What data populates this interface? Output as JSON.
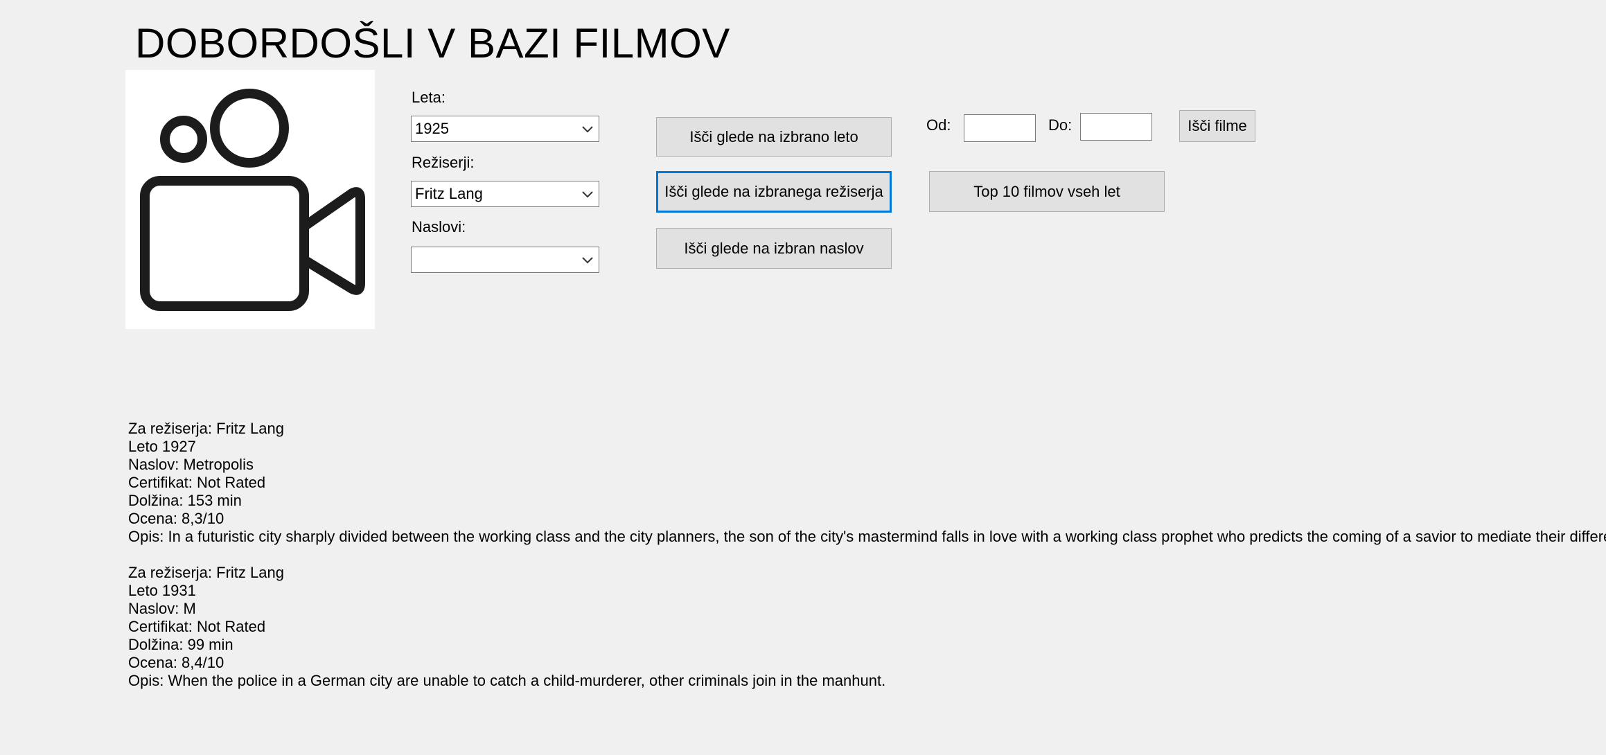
{
  "header": {
    "title": "DOBORDOŠLI V BAZI FILMOV"
  },
  "logo": {
    "icon": "video-camera-icon"
  },
  "filters": {
    "year_label": "Leta:",
    "year_value": "1925",
    "director_label": "Režiserji:",
    "director_value": "Fritz Lang",
    "title_label": "Naslovi:",
    "title_value": ""
  },
  "buttons": {
    "search_year": "Išči glede na izbrano leto",
    "search_director": "Išči glede na izbranega režiserja",
    "search_title": "Išči glede na izbran naslov",
    "top10": "Top 10 filmov vseh let",
    "search_films": "Išči filme"
  },
  "range": {
    "from_label": "Od:",
    "from_value": "",
    "to_label": "Do:",
    "to_value": ""
  },
  "results": [
    {
      "director": "Za režiserja: Fritz Lang",
      "year": "Leto 1927",
      "title": "Naslov: Metropolis",
      "certificate": "Certifikat: Not Rated",
      "length": "Dolžina: 153 min",
      "rating": "Ocena: 8,3/10",
      "description": "Opis: In a futuristic city sharply divided between the working class and the city planners, the son of the city's mastermind falls in love with a working class prophet who predicts the coming of a savior to mediate their differences."
    },
    {
      "director": "Za režiserja: Fritz Lang",
      "year": "Leto 1931",
      "title": "Naslov: M",
      "certificate": "Certifikat: Not Rated",
      "length": "Dolžina: 99 min",
      "rating": "Ocena: 8,4/10",
      "description": "Opis: When the police in a German city are unable to catch a child-murderer, other criminals join in the manhunt."
    }
  ]
}
